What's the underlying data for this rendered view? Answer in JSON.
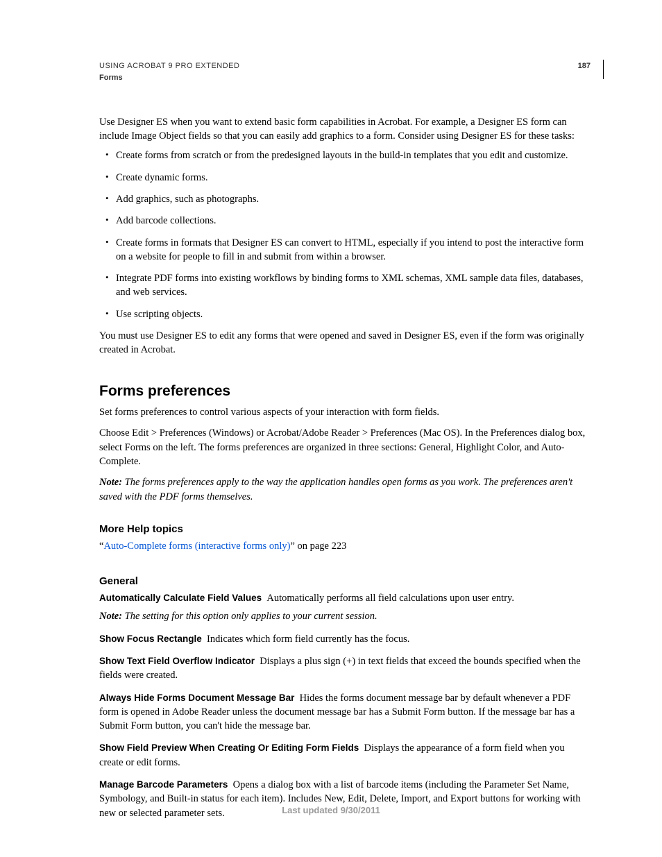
{
  "header": {
    "title": "USING ACROBAT 9 PRO EXTENDED",
    "subtitle": "Forms",
    "page_number": "187"
  },
  "intro": "Use Designer ES when you want to extend basic form capabilities in Acrobat. For example, a Designer ES form can include Image Object fields so that you can easily add graphics to a form. Consider using Designer ES for these tasks:",
  "bullets": [
    "Create forms from scratch or from the predesigned layouts in the build-in templates that you edit and customize.",
    "Create dynamic forms.",
    "Add graphics, such as photographs.",
    "Add barcode collections.",
    "Create forms in formats that Designer ES can convert to HTML, especially if you intend to post the interactive form on a website for people to fill in and submit from within a browser.",
    "Integrate PDF forms into existing workflows by binding forms to XML schemas, XML sample data files, databases, and web services.",
    "Use scripting objects."
  ],
  "after_bullets": "You must use Designer ES to edit any forms that were opened and saved in Designer ES, even if the form was originally created in Acrobat.",
  "section_heading": "Forms preferences",
  "section_para1": "Set forms preferences to control various aspects of your interaction with form fields.",
  "section_para2": "Choose Edit > Preferences (Windows) or Acrobat/Adobe Reader > Preferences (Mac OS). In the Preferences dialog box, select Forms on the left. The forms preferences are organized in three sections: General, Highlight Color, and Auto-Complete.",
  "note1_label": "Note:",
  "note1_body": "The forms preferences apply to the way the application handles open forms as you work. The preferences aren't saved with the PDF forms themselves.",
  "more_help_heading": "More Help topics",
  "more_help_quote_open": "“",
  "more_help_link": "Auto-Complete forms (interactive forms only)",
  "more_help_suffix": "” on page 223",
  "general_heading": "General",
  "options": [
    {
      "label": "Automatically Calculate Field Values",
      "desc": "Automatically performs all field calculations upon user entry."
    },
    {
      "label": "Show Focus Rectangle",
      "desc": "Indicates which form field currently has the focus."
    },
    {
      "label": "Show Text Field Overflow Indicator",
      "desc": "Displays a plus sign (+) in text fields that exceed the bounds specified when the fields were created."
    },
    {
      "label": "Always Hide Forms Document Message Bar",
      "desc": "Hides the forms document message bar by default whenever a PDF form is opened in Adobe Reader unless the document message bar has a Submit Form button. If the message bar has a Submit Form button, you can't hide the message bar."
    },
    {
      "label": "Show Field Preview When Creating Or Editing Form Fields",
      "desc": "Displays the appearance of a form field when you create or edit forms."
    },
    {
      "label": "Manage Barcode Parameters",
      "desc": "Opens a dialog box with a list of barcode items (including the Parameter Set Name, Symbology, and Built-in status for each item). Includes New, Edit, Delete, Import, and Export buttons for working with new or selected parameter sets."
    }
  ],
  "note2_label": "Note:",
  "note2_body": "The setting for this option only applies to your current session.",
  "footer": "Last updated 9/30/2011"
}
